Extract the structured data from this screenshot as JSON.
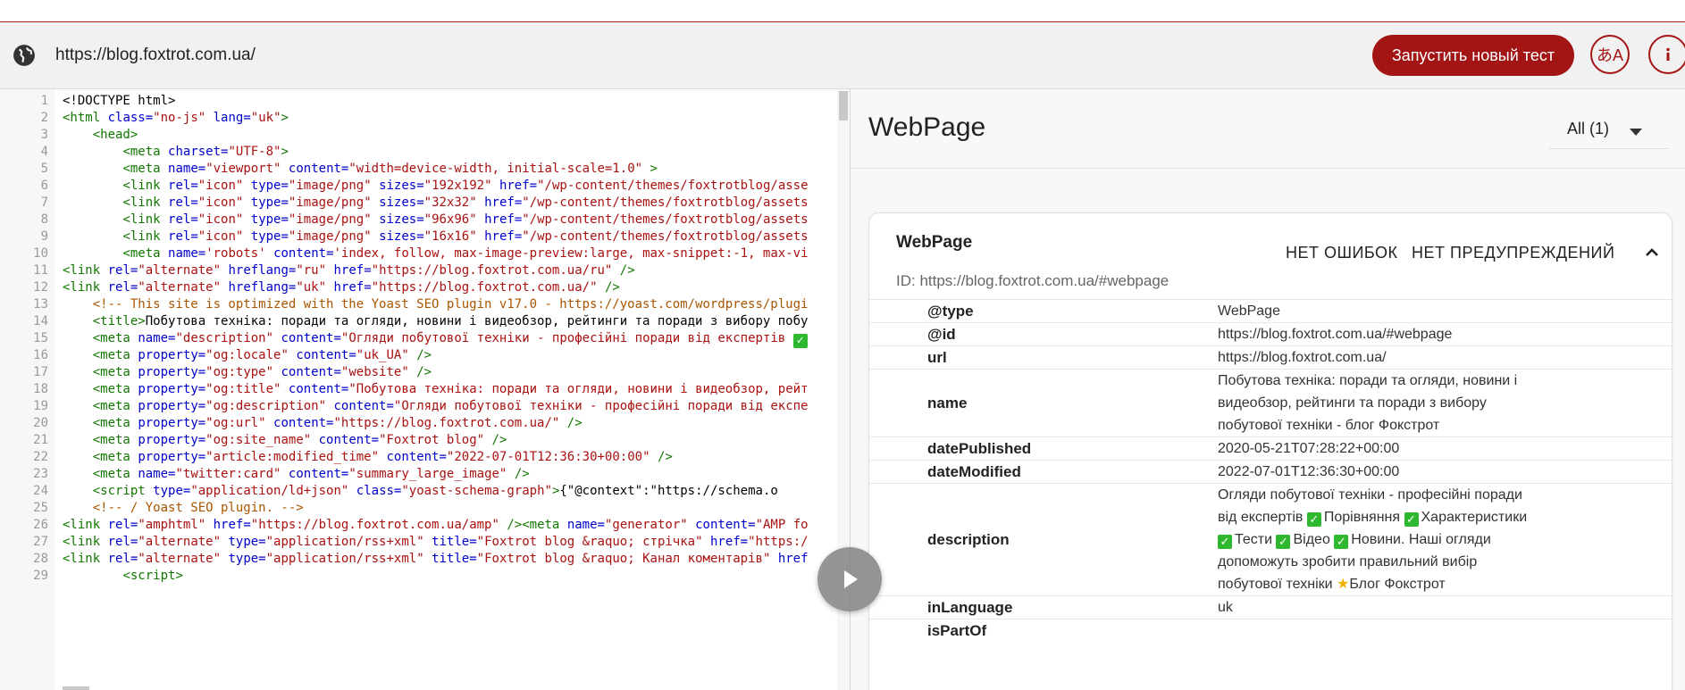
{
  "browser": {
    "url": "https://blog.foxtrot.com.ua/",
    "run_test_label": "Запустить новый тест",
    "lang_icon_glyph": "あA"
  },
  "code": {
    "lines": [
      {
        "n": "1",
        "html": "<span class=\"txt\">&lt;!DOCTYPE html&gt;</span>"
      },
      {
        "n": "2",
        "html": "<span class=\"tag\">&lt;html</span> <span class=\"attr\">class=</span><span class=\"val\">\"no-js\"</span> <span class=\"attr\">lang=</span><span class=\"val\">\"uk\"</span><span class=\"tag\">&gt;</span>"
      },
      {
        "n": "3",
        "html": "    <span class=\"tag\">&lt;head&gt;</span>"
      },
      {
        "n": "4",
        "html": "        <span class=\"tag\">&lt;meta</span> <span class=\"attr\">charset=</span><span class=\"val\">\"UTF-8\"</span><span class=\"tag\">&gt;</span>"
      },
      {
        "n": "5",
        "html": "        <span class=\"tag\">&lt;meta</span> <span class=\"attr\">name=</span><span class=\"val\">\"viewport\"</span> <span class=\"attr\">content=</span><span class=\"val\">\"width=device-width, initial-scale=1.0\"</span> <span class=\"tag\">&gt;</span>"
      },
      {
        "n": "6",
        "html": "        <span class=\"tag\">&lt;link</span> <span class=\"attr\">rel=</span><span class=\"val\">\"icon\"</span> <span class=\"attr\">type=</span><span class=\"val\">\"image/png\"</span> <span class=\"attr\">sizes=</span><span class=\"val\">\"192x192\"</span> <span class=\"attr\">href=</span><span class=\"val\">\"/wp-content/themes/foxtrotblog/asse</span>"
      },
      {
        "n": "7",
        "html": "        <span class=\"tag\">&lt;link</span> <span class=\"attr\">rel=</span><span class=\"val\">\"icon\"</span> <span class=\"attr\">type=</span><span class=\"val\">\"image/png\"</span> <span class=\"attr\">sizes=</span><span class=\"val\">\"32x32\"</span> <span class=\"attr\">href=</span><span class=\"val\">\"/wp-content/themes/foxtrotblog/assets</span>"
      },
      {
        "n": "8",
        "html": "        <span class=\"tag\">&lt;link</span> <span class=\"attr\">rel=</span><span class=\"val\">\"icon\"</span> <span class=\"attr\">type=</span><span class=\"val\">\"image/png\"</span> <span class=\"attr\">sizes=</span><span class=\"val\">\"96x96\"</span> <span class=\"attr\">href=</span><span class=\"val\">\"/wp-content/themes/foxtrotblog/assets</span>"
      },
      {
        "n": "9",
        "html": "        <span class=\"tag\">&lt;link</span> <span class=\"attr\">rel=</span><span class=\"val\">\"icon\"</span> <span class=\"attr\">type=</span><span class=\"val\">\"image/png\"</span> <span class=\"attr\">sizes=</span><span class=\"val\">\"16x16\"</span> <span class=\"attr\">href=</span><span class=\"val\">\"/wp-content/themes/foxtrotblog/assets</span>"
      },
      {
        "n": "10",
        "html": "        <span class=\"tag\">&lt;meta</span> <span class=\"attr\">name=</span><span class=\"val\">'robots'</span> <span class=\"attr\">content=</span><span class=\"val\">'index, follow, max-image-preview:large, max-snippet:-1, max-vi</span>"
      },
      {
        "n": "11",
        "html": "<span class=\"tag\">&lt;link</span> <span class=\"attr\">rel=</span><span class=\"val\">\"alternate\"</span> <span class=\"attr\">hreflang=</span><span class=\"val\">\"ru\"</span> <span class=\"attr\">href=</span><span class=\"val\">\"https://blog.foxtrot.com.ua/ru\"</span> <span class=\"tag\">/&gt;</span>"
      },
      {
        "n": "12",
        "html": "<span class=\"tag\">&lt;link</span> <span class=\"attr\">rel=</span><span class=\"val\">\"alternate\"</span> <span class=\"attr\">hreflang=</span><span class=\"val\">\"uk\"</span> <span class=\"attr\">href=</span><span class=\"val\">\"https://blog.foxtrot.com.ua/\"</span> <span class=\"tag\">/&gt;</span>"
      },
      {
        "n": "13",
        "html": "    <span class=\"cmt\">&lt;!-- This site is optimized with the Yoast SEO plugin v17.0 - https://yoast.com/wordpress/plugi</span>"
      },
      {
        "n": "14",
        "html": "    <span class=\"tag\">&lt;title&gt;</span><span class=\"txt\">Побутова техніка: поради та огляди, новини і видеобзор, рейтинги та поради з вибору побу</span>"
      },
      {
        "n": "15",
        "html": "    <span class=\"tag\">&lt;meta</span> <span class=\"attr\">name=</span><span class=\"val\">\"description\"</span> <span class=\"attr\">content=</span><span class=\"val\">\"Огляди побутової техніки - професійні поради від експертів </span><span class=\"check\">✓</span>"
      },
      {
        "n": "16",
        "html": "    <span class=\"tag\">&lt;meta</span> <span class=\"attr\">property=</span><span class=\"val\">\"og:locale\"</span> <span class=\"attr\">content=</span><span class=\"val\">\"uk_UA\"</span> <span class=\"tag\">/&gt;</span>"
      },
      {
        "n": "17",
        "html": "    <span class=\"tag\">&lt;meta</span> <span class=\"attr\">property=</span><span class=\"val\">\"og:type\"</span> <span class=\"attr\">content=</span><span class=\"val\">\"website\"</span> <span class=\"tag\">/&gt;</span>"
      },
      {
        "n": "18",
        "html": "    <span class=\"tag\">&lt;meta</span> <span class=\"attr\">property=</span><span class=\"val\">\"og:title\"</span> <span class=\"attr\">content=</span><span class=\"val\">\"Побутова техніка: поради та огляди, новини і видеобзор, рейт</span>"
      },
      {
        "n": "19",
        "html": "    <span class=\"tag\">&lt;meta</span> <span class=\"attr\">property=</span><span class=\"val\">\"og:description\"</span> <span class=\"attr\">content=</span><span class=\"val\">\"Огляди побутової техніки - професійні поради від експе</span>"
      },
      {
        "n": "20",
        "html": "    <span class=\"tag\">&lt;meta</span> <span class=\"attr\">property=</span><span class=\"val\">\"og:url\"</span> <span class=\"attr\">content=</span><span class=\"val\">\"https://blog.foxtrot.com.ua/\"</span> <span class=\"tag\">/&gt;</span>"
      },
      {
        "n": "21",
        "html": "    <span class=\"tag\">&lt;meta</span> <span class=\"attr\">property=</span><span class=\"val\">\"og:site_name\"</span> <span class=\"attr\">content=</span><span class=\"val\">\"Foxtrot blog\"</span> <span class=\"tag\">/&gt;</span>"
      },
      {
        "n": "22",
        "html": "    <span class=\"tag\">&lt;meta</span> <span class=\"attr\">property=</span><span class=\"val\">\"article:modified_time\"</span> <span class=\"attr\">content=</span><span class=\"val\">\"2022-07-01T12:36:30+00:00\"</span> <span class=\"tag\">/&gt;</span>"
      },
      {
        "n": "23",
        "html": "    <span class=\"tag\">&lt;meta</span> <span class=\"attr\">name=</span><span class=\"val\">\"twitter:card\"</span> <span class=\"attr\">content=</span><span class=\"val\">\"summary_large_image\"</span> <span class=\"tag\">/&gt;</span>"
      },
      {
        "n": "24",
        "html": "    <span class=\"tag\">&lt;script</span> <span class=\"attr\">type=</span><span class=\"val\">\"application/ld+json\"</span> <span class=\"attr\">class=</span><span class=\"val\">\"yoast-schema-graph\"</span><span class=\"tag\">&gt;</span><span class=\"txt\">{\"@context\":\"https://schema.o</span>"
      },
      {
        "n": "25",
        "html": "    <span class=\"cmt\">&lt;!-- / Yoast SEO plugin. --&gt;</span>"
      },
      {
        "n": "26",
        "html": "<span class=\"tag\">&lt;link</span> <span class=\"attr\">rel=</span><span class=\"val\">\"amphtml\"</span> <span class=\"attr\">href=</span><span class=\"val\">\"https://blog.foxtrot.com.ua/amp\"</span> <span class=\"tag\">/&gt;&lt;meta</span> <span class=\"attr\">name=</span><span class=\"val\">\"generator\"</span> <span class=\"attr\">content=</span><span class=\"val\">\"AMP fo</span>"
      },
      {
        "n": "27",
        "html": "<span class=\"tag\">&lt;link</span> <span class=\"attr\">rel=</span><span class=\"val\">\"alternate\"</span> <span class=\"attr\">type=</span><span class=\"val\">\"application/rss+xml\"</span> <span class=\"attr\">title=</span><span class=\"val\">\"Foxtrot blog &amp;raquo; стрічка\"</span> <span class=\"attr\">href=</span><span class=\"val\">\"https:/</span>"
      },
      {
        "n": "28",
        "html": "<span class=\"tag\">&lt;link</span> <span class=\"attr\">rel=</span><span class=\"val\">\"alternate\"</span> <span class=\"attr\">type=</span><span class=\"val\">\"application/rss+xml\"</span> <span class=\"attr\">title=</span><span class=\"val\">\"Foxtrot blog &amp;raquo; Канал коментарів\"</span> <span class=\"attr\">href</span>"
      },
      {
        "n": "29",
        "html": "        <span class=\"tag\">&lt;script&gt;</span>"
      }
    ]
  },
  "results": {
    "type_title": "WebPage",
    "filter_label": "All (1)",
    "card": {
      "title": "WebPage",
      "id": "ID: https://blog.foxtrot.com.ua/#webpage",
      "errors_label": "НЕТ ОШИБОК",
      "warnings_label": "НЕТ ПРЕДУПРЕЖДЕНИЙ",
      "properties": [
        {
          "key": "@type",
          "value": "WebPage",
          "bold": false
        },
        {
          "key": "@id",
          "value": "https://blog.foxtrot.com.ua/#webpage",
          "bold": true
        },
        {
          "key": "url",
          "value": "https://blog.foxtrot.com.ua/",
          "bold": true
        },
        {
          "key": "name",
          "value": "Побутова техніка: поради та огляди, новини і видеобзор, рейтинги та поради з вибору побутової техніки - блог Фокстрот",
          "bold": true
        },
        {
          "key": "datePublished",
          "value": "2020-05-21T07:28:22+00:00",
          "bold": true
        },
        {
          "key": "dateModified",
          "value": "2022-07-01T12:36:30+00:00",
          "bold": true
        },
        {
          "key": "description",
          "value_parts": [
            "Огляди побутової техніки - професійні поради від експертів ",
            "Порівняння ",
            "Характеристики ",
            "Тести ",
            "Відео ",
            "Новини. Наші огляди допоможуть зробити правильний вибір побутової техніки ",
            "Блог Фокстрот"
          ],
          "bold": true
        },
        {
          "key": "inLanguage",
          "value": "uk",
          "bold": true
        },
        {
          "key": "isPartOf",
          "value": "",
          "bold": true
        }
      ]
    }
  },
  "colors": {
    "accent": "#a31515",
    "tag": "#117700",
    "attr": "#0000cc",
    "value": "#aa1111",
    "comment": "#aa5500"
  },
  "icons": {
    "globe": "globe-icon",
    "language": "translate-icon",
    "info": "info-icon",
    "dropdown": "caret-down-icon",
    "collapse": "chevron-up-icon",
    "play": "play-icon",
    "check": "check-mark-icon",
    "star": "star-icon"
  }
}
